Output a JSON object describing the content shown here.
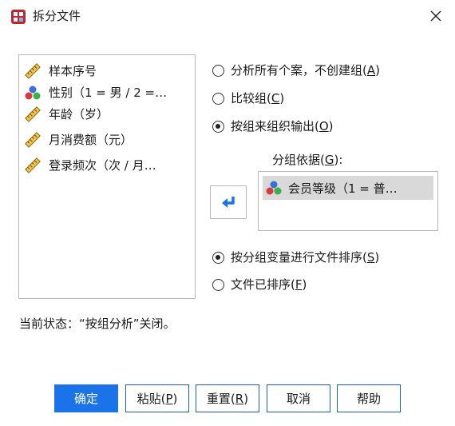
{
  "window": {
    "title": "拆分文件",
    "app_icon": "spss-split-icon",
    "close_icon": "close-icon"
  },
  "variables": [
    {
      "label": "样本序号",
      "icon": "ruler-scale-icon"
    },
    {
      "label": "性别（1 = 男 / 2 =…",
      "icon": "nominal-balls-icon"
    },
    {
      "label": "年龄（岁）",
      "icon": "ruler-scale-icon"
    },
    {
      "label": "月消费额（元）",
      "icon": "ruler-scale-icon"
    },
    {
      "label": "登录频次（次 / 月…",
      "icon": "ruler-scale-icon"
    }
  ],
  "analysis_mode": {
    "options": [
      {
        "prefix": "分析所有个案，不创建组(",
        "key": "A",
        "suffix": ")",
        "checked": false
      },
      {
        "prefix": "比较组(",
        "key": "C",
        "suffix": ")",
        "checked": false
      },
      {
        "prefix": "按组来组织输出(",
        "key": "O",
        "suffix": ")",
        "checked": true
      }
    ]
  },
  "group_by": {
    "label_prefix": "分组依据(",
    "label_key": "G",
    "label_suffix": "):",
    "items": [
      {
        "label": "会员等级（1 = 普…",
        "icon": "nominal-balls-icon"
      }
    ],
    "move_icon": "arrow-left-icon"
  },
  "sort_mode": {
    "options": [
      {
        "prefix": "按分组变量进行文件排序(",
        "key": "S",
        "suffix": ")",
        "checked": true
      },
      {
        "prefix": "文件已排序(",
        "key": "F",
        "suffix": ")",
        "checked": false
      }
    ]
  },
  "status": "当前状态：“按组分析”关闭。",
  "buttons": {
    "ok": "确定",
    "paste_prefix": "粘贴(",
    "paste_key": "P",
    "paste_suffix": ")",
    "reset_prefix": "重置(",
    "reset_key": "R",
    "reset_suffix": ")",
    "cancel": "取消",
    "help": "帮助"
  },
  "colors": {
    "accent": "#1a73e8",
    "button_border": "#1f5fa8",
    "selection": "#d9d9d9"
  }
}
